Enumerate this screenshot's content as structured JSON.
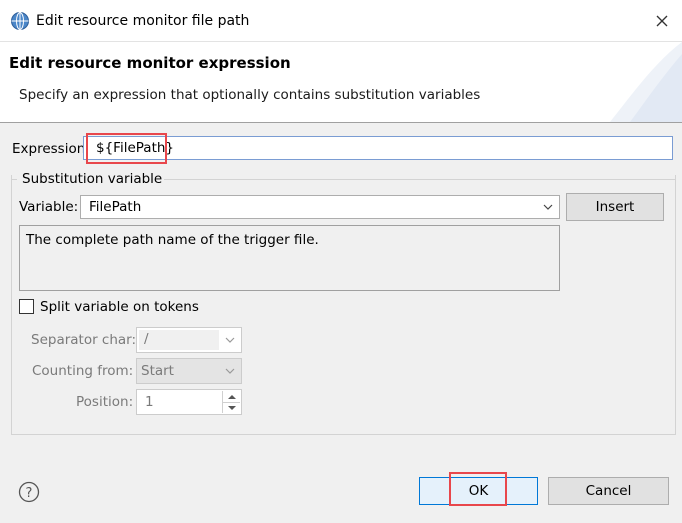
{
  "window": {
    "title": "Edit resource monitor file path",
    "close_icon": "close-icon"
  },
  "header": {
    "title": "Edit resource monitor expression",
    "description": "Specify an expression that optionally contains substitution variables"
  },
  "expression": {
    "label": "Expression:",
    "value": "${FilePath}"
  },
  "substitution": {
    "group_title": "Substitution variable",
    "variable_label": "Variable:",
    "variable_value": "FilePath",
    "insert_label": "Insert",
    "description": "The complete path name of the trigger file.",
    "split_label": "Split variable on tokens",
    "split_checked": false,
    "separator_label": "Separator char:",
    "separator_value": "/",
    "counting_label": "Counting from:",
    "counting_value": "Start",
    "position_label": "Position:",
    "position_value": "1"
  },
  "footer": {
    "help_icon": "help-icon",
    "ok_label": "OK",
    "cancel_label": "Cancel"
  },
  "colors": {
    "highlight": "#e8474c",
    "focus_border": "#0078d7",
    "dialog_bg": "#f0f0f0"
  }
}
